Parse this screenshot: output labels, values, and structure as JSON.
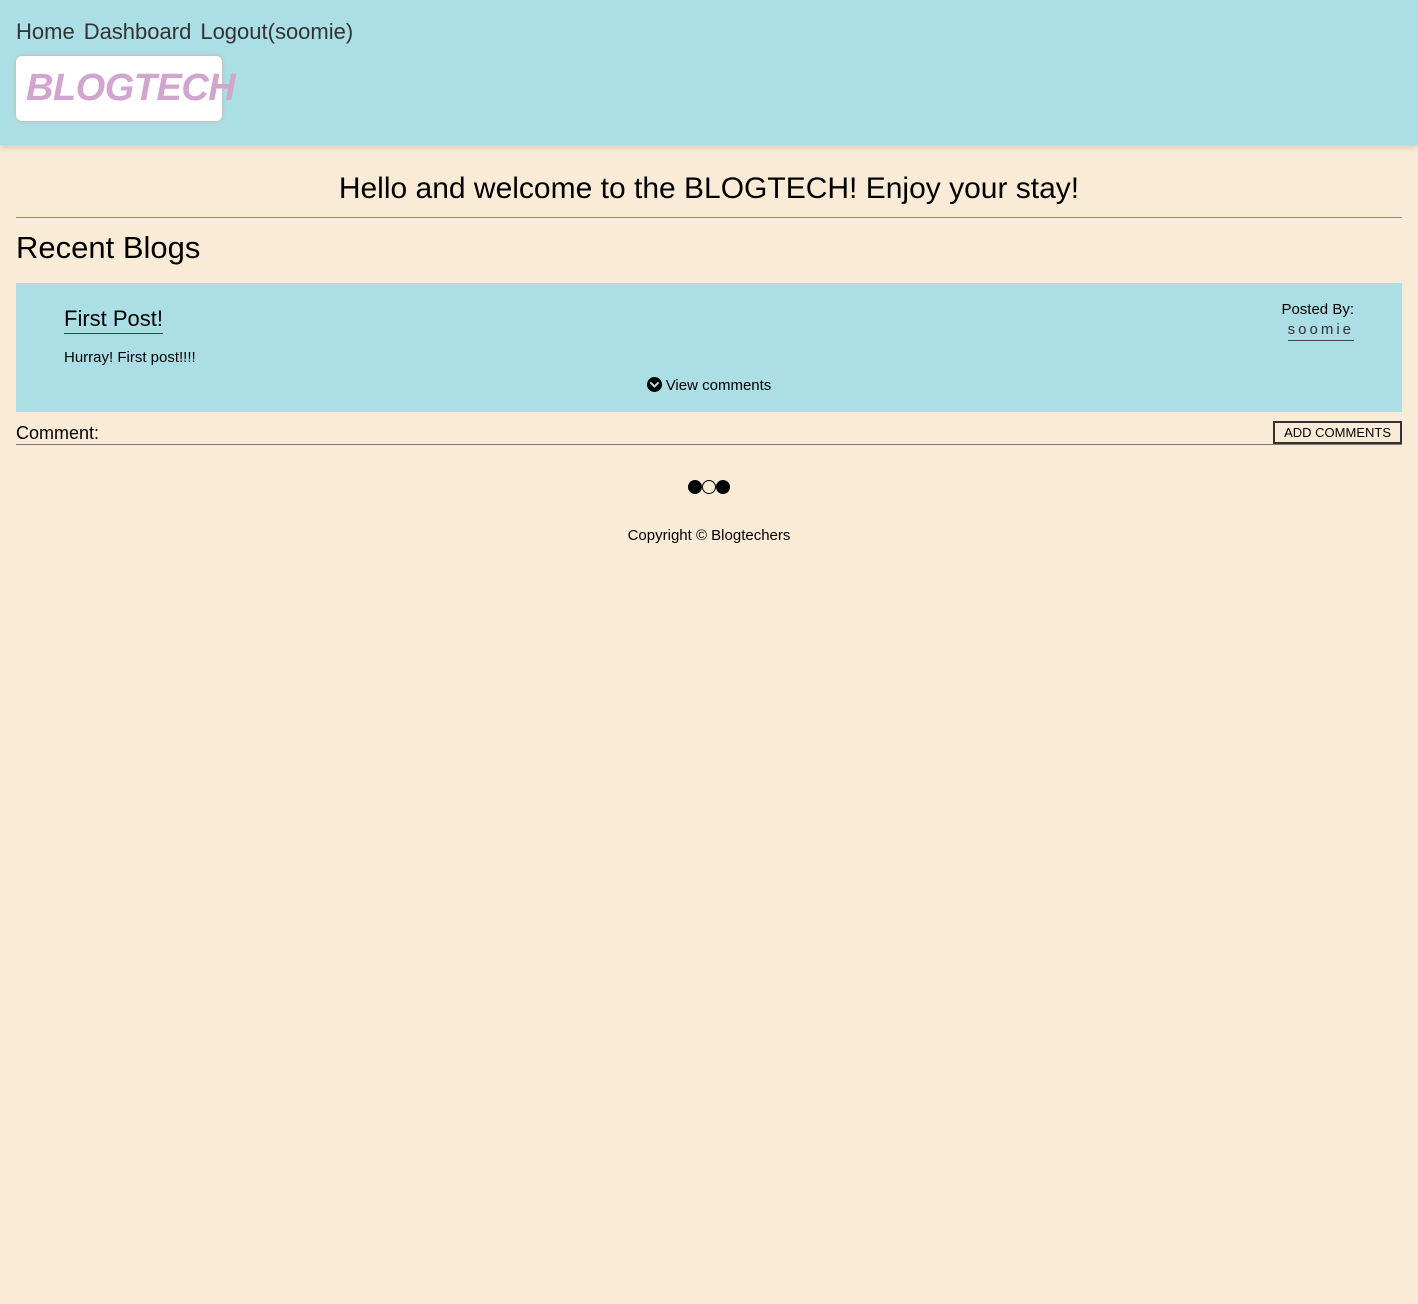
{
  "nav": {
    "items": [
      {
        "label": "Home"
      },
      {
        "label": "Dashboard"
      },
      {
        "label": "Logout(soomie)"
      }
    ]
  },
  "logo": {
    "text": "BLOGTECH"
  },
  "welcome": {
    "text": "Hello and welcome to the BLOGTECH! Enjoy your stay!"
  },
  "recent": {
    "title": "Recent Blogs",
    "posts": [
      {
        "title": "First Post!",
        "body": "Hurray! First post!!!!",
        "posted_by_label": "Posted By:",
        "author": "soomie",
        "view_comments_label": "View comments"
      }
    ]
  },
  "comment_form": {
    "label": "Comment:",
    "input_value": "",
    "input_placeholder": "",
    "submit_label": "ADD COMMENTS"
  },
  "pagination": {
    "dots": [
      "filled",
      "empty",
      "filled"
    ]
  },
  "footer": {
    "text": "Copyright © Blogtechers"
  },
  "colors": {
    "header_bg": "#acdee6",
    "page_bg": "#faebd7",
    "logo_text": "#d1a5cf",
    "card_bg": "#acdee6"
  }
}
